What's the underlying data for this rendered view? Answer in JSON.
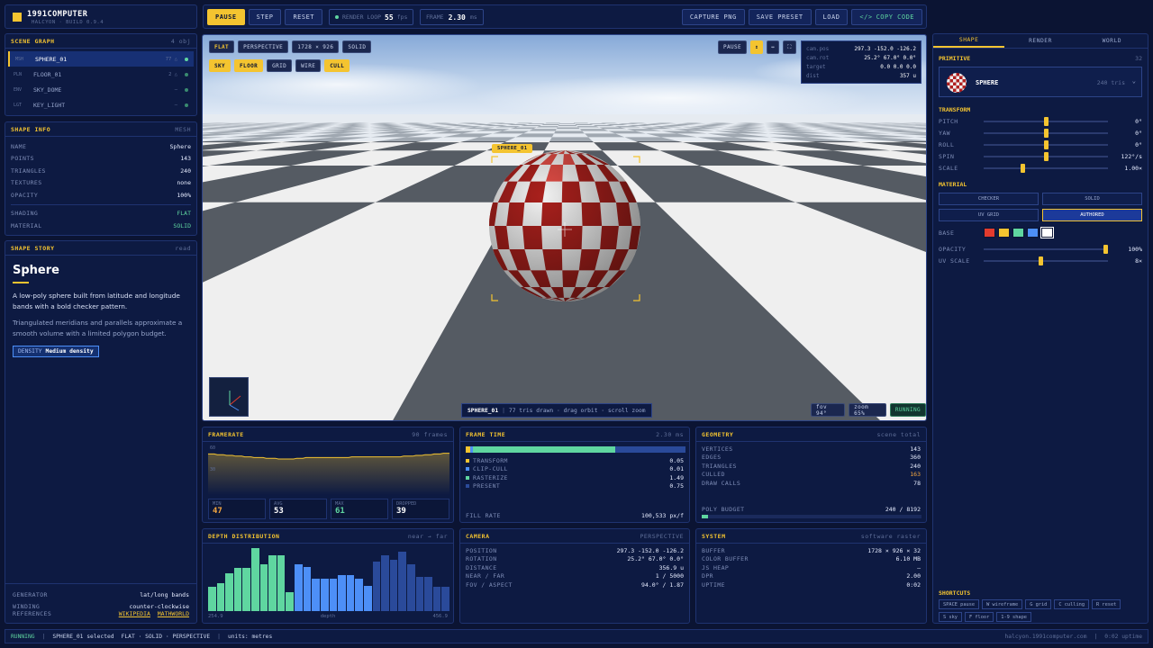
{
  "app": {
    "title": "1991COMPUTER",
    "subtitle": "HALCYON · BUILD 0.9.4"
  },
  "toolbar": {
    "pause": "PAUSE",
    "step": "STEP",
    "reset": "RESET",
    "render_loop_label": "RENDER LOOP",
    "fps_value": "55",
    "fps_unit": "fps",
    "frame_label": "FRAME",
    "frame_value": "2.30",
    "frame_unit": "ms",
    "capture": "CAPTURE PNG",
    "save_preset": "SAVE PRESET",
    "load": "LOAD",
    "copy_code": "COPY CODE"
  },
  "scene_graph": {
    "title": "SCENE GRAPH",
    "count": "4 obj",
    "items": [
      {
        "type": "MSH",
        "name": "SPHERE_01",
        "info": "77 △"
      },
      {
        "type": "PLN",
        "name": "FLOOR_01",
        "info": "2 △"
      },
      {
        "type": "ENV",
        "name": "SKY_DOME",
        "info": "—"
      },
      {
        "type": "LGT",
        "name": "KEY_LIGHT",
        "info": "—"
      }
    ]
  },
  "shape_info": {
    "title": "SHAPE INFO",
    "tag": "MESH",
    "rows": [
      {
        "k": "NAME",
        "v": "Sphere"
      },
      {
        "k": "POINTS",
        "v": "143"
      },
      {
        "k": "TRIANGLES",
        "v": "240"
      },
      {
        "k": "TEXTURES",
        "v": "none"
      },
      {
        "k": "OPACITY",
        "v": "100%"
      }
    ],
    "rows2": [
      {
        "k": "SHADING",
        "v": "FLAT"
      },
      {
        "k": "MATERIAL",
        "v": "SOLID"
      }
    ]
  },
  "story": {
    "title": "SHAPE STORY",
    "tag": "read",
    "heading": "Sphere",
    "p1": "A low-poly sphere built from latitude and longitude bands with a bold checker pattern.",
    "p2": "Triangulated meridians and parallels approximate a smooth volume with a limited polygon budget.",
    "density_label": "DENSITY",
    "density_value": "Medium density",
    "meta": [
      {
        "k": "GENERATOR",
        "v": "lat/long bands"
      },
      {
        "k": "WINDING",
        "v": "counter-clockwise"
      }
    ],
    "refs_label": "REFERENCES",
    "ref1": "WIKIPEDIA",
    "ref2": "MATHWORLD"
  },
  "viewport": {
    "tags_row1": [
      "FLAT",
      "PERSPECTIVE",
      "1728 × 926",
      "SOLID"
    ],
    "tags_row2": [
      "SKY",
      "FLOOR",
      "GRID",
      "WIRE",
      "CULL"
    ],
    "pause": "PAUSE",
    "cam": [
      {
        "k": "cam.pos",
        "v": "297.3 -152.0 -126.2"
      },
      {
        "k": "cam.rot",
        "v": "25.2° 67.0° 0.0°"
      },
      {
        "k": "target",
        "v": "0.0 0.0 0.0"
      },
      {
        "k": "dist",
        "v": "357 u"
      }
    ],
    "label": "SPHERE_01",
    "status_name": "SPHERE_01",
    "status_text": "77 tris drawn · drag orbit · scroll zoom",
    "fov": "fov 94°",
    "zoom": "zoom 65%",
    "running": "RUNNING"
  },
  "right": {
    "tabs": [
      "SHAPE",
      "RENDER",
      "WORLD"
    ],
    "primitive_label": "PRIMITIVE",
    "primitive_count": "32",
    "primitive_name": "SPHERE",
    "primitive_tris": "240 tris",
    "transform_label": "TRANSFORM",
    "transform": [
      {
        "k": "PITCH",
        "v": "0°",
        "level": 0.5
      },
      {
        "k": "YAW",
        "v": "0°",
        "level": 0.5
      },
      {
        "k": "ROLL",
        "v": "0°",
        "level": 0.5
      },
      {
        "k": "SPIN",
        "v": "122°/s",
        "level": 0.5
      },
      {
        "k": "SCALE",
        "v": "1.00×",
        "level": 0.31
      }
    ],
    "material_label": "MATERIAL",
    "materials": [
      "CHECKER",
      "SOLID",
      "UV GRID",
      "AUTHORED"
    ],
    "base_label": "BASE",
    "swatches": [
      "#e23b2e",
      "#f4c430",
      "#5fd6a0",
      "#4d8ff7",
      "#ffffff"
    ],
    "opacity_label": "OPACITY",
    "opacity_value": "100%",
    "opacity_level": 1.0,
    "uvscale_label": "UV SCALE",
    "uvscale_value": "8×",
    "uvscale_level": 0.46,
    "shortcuts_label": "SHORTCUTS",
    "shortcuts": [
      "SPACE pause",
      "W wireframe",
      "G grid",
      "C culling",
      "R reset",
      "S sky",
      "F floor",
      "1-9 shape"
    ]
  },
  "framerate": {
    "title": "FRAMERATE",
    "tag": "90 frames",
    "y_top": "60",
    "y_mid": "30",
    "stats": [
      {
        "k": "MIN",
        "v": "47"
      },
      {
        "k": "AVG",
        "v": "53"
      },
      {
        "k": "MAX",
        "v": "61"
      },
      {
        "k": "DROPPED",
        "v": "39"
      }
    ],
    "series": [
      57,
      57,
      57,
      56,
      56,
      56,
      55,
      55,
      55,
      54,
      54,
      54,
      53,
      53,
      53,
      52,
      52,
      52,
      52,
      51,
      51,
      51,
      51,
      50,
      50,
      50,
      50,
      50,
      50,
      51,
      51,
      51,
      52,
      52,
      52,
      52,
      52,
      52,
      52,
      52,
      52,
      52,
      52,
      52,
      52,
      52,
      52,
      53,
      53,
      53,
      53,
      53,
      53,
      53,
      53,
      53,
      53,
      53,
      53,
      53,
      53,
      53,
      53,
      53,
      54,
      54,
      54,
      54,
      55,
      55,
      55,
      56,
      56,
      56,
      57,
      57,
      57,
      58,
      58,
      58
    ]
  },
  "frametime": {
    "title": "FRAME TIME",
    "tag": "2.30 ms",
    "rows": [
      {
        "k": "TRANSFORM",
        "v": "0.05",
        "c": "#f4c430"
      },
      {
        "k": "CLIP-CULL",
        "v": "0.01",
        "c": "#4d8ff7"
      },
      {
        "k": "RASTERIZE",
        "v": "1.49",
        "c": "#5fd6a0"
      },
      {
        "k": "PRESENT",
        "v": "0.75",
        "c": "#2a4a9a"
      }
    ],
    "fill_label": "FILL RATE",
    "fill_value": "100,533 px/f"
  },
  "geometry": {
    "title": "GEOMETRY",
    "tag": "scene total",
    "rows": [
      {
        "k": "VERTICES",
        "v": "143"
      },
      {
        "k": "EDGES",
        "v": "360"
      },
      {
        "k": "TRIANGLES",
        "v": "240"
      },
      {
        "k": "CULLED",
        "v": "163"
      },
      {
        "k": "DRAW CALLS",
        "v": "78"
      }
    ],
    "budget_label": "POLY BUDGET",
    "budget_value": "240 / 8192",
    "budget_level": 0.03
  },
  "depth": {
    "title": "DEPTH DISTRIBUTION",
    "tag": "near → far",
    "x_min": "254.9",
    "x_label": "depth",
    "x_max": "456.9",
    "bins": [
      0.38,
      0.45,
      0.6,
      0.68,
      0.68,
      1.0,
      0.75,
      0.88,
      0.88,
      0.3,
      0.75,
      0.7,
      0.52,
      0.52,
      0.52,
      0.57,
      0.57,
      0.52,
      0.4,
      0.78,
      0.88,
      0.82,
      0.95,
      0.75,
      0.55,
      0.55,
      0.38,
      0.38
    ]
  },
  "camera": {
    "title": "CAMERA",
    "tag": "PERSPECTIVE",
    "rows": [
      {
        "k": "POSITION",
        "v": "297.3 -152.0 -126.2"
      },
      {
        "k": "ROTATION",
        "v": "25.2° 67.0° 0.0°"
      },
      {
        "k": "DISTANCE",
        "v": "356.9 u"
      },
      {
        "k": "NEAR / FAR",
        "v": "1 / 5000"
      },
      {
        "k": "FOV / ASPECT",
        "v": "94.0° / 1.87"
      }
    ]
  },
  "system": {
    "title": "SYSTEM",
    "tag": "software raster",
    "rows": [
      {
        "k": "BUFFER",
        "v": "1728 × 926 × 32"
      },
      {
        "k": "COLOR BUFFER",
        "v": "6.10 MB"
      },
      {
        "k": "JS HEAP",
        "v": "—"
      },
      {
        "k": "DPR",
        "v": "2.00"
      },
      {
        "k": "UPTIME",
        "v": "0:02"
      }
    ]
  },
  "statusbar": {
    "state": "RUNNING",
    "selected": "SPHERE_01 selected",
    "mode": "FLAT · SOLID · PERSPECTIVE",
    "units": "units: metres",
    "host": "halcyon.1991computer.com",
    "uptime": "0:02 uptime"
  }
}
